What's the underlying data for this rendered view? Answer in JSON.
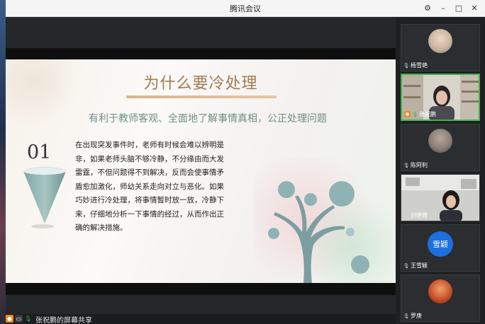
{
  "window": {
    "title": "腾讯会议"
  },
  "window_controls": {
    "settings": "⚙",
    "minimize": "–",
    "maximize": "□",
    "close": "✕"
  },
  "slide": {
    "title": "为什么要冷处理",
    "subtitle": "有利于教师客观、全面地了解事情真相，公正处理问题",
    "number": "01",
    "body_lines": [
      "在出现突发事件时，老师有时候会难以辨明是",
      "非，如果老师头脑不够冷静，不分缘由而大发",
      "雷霆，不但问题得不到解决，反而会使事情矛",
      "盾愈加激化，师幼关系走向对立与恶化。如果",
      "巧妙进行冷处理，将事情暂时放一放，冷静下",
      "来，仔细地分析一下事情的经过，从而作出正",
      "确的解决措施。"
    ]
  },
  "status": {
    "share_text": "张祝鹏的屏幕共享"
  },
  "participants": [
    {
      "name": "杨雪艳",
      "type": "photo",
      "color": "#c9b6a3"
    },
    {
      "name": "张祝鹏",
      "type": "video",
      "host": true,
      "active": true
    },
    {
      "name": "陈阿利",
      "type": "photo",
      "color": "#8a7f78"
    },
    {
      "name": "刘艳霞",
      "type": "video"
    },
    {
      "name": "王雪颖",
      "type": "text-avatar",
      "avatar_text": "雪颖",
      "color": "#1d6fe0"
    },
    {
      "name": "罗庚",
      "type": "photo",
      "color": "#c8532a"
    }
  ]
}
